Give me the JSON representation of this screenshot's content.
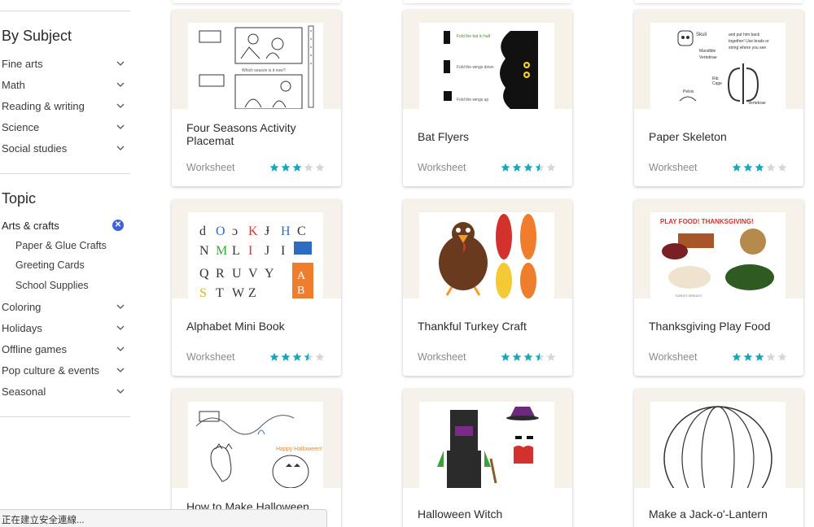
{
  "sidebar": {
    "subject_heading": "By Subject",
    "subjects": [
      {
        "label": "Fine arts"
      },
      {
        "label": "Math"
      },
      {
        "label": "Reading & writing"
      },
      {
        "label": "Science"
      },
      {
        "label": "Social studies"
      }
    ],
    "topic_heading": "Topic",
    "active_topic": "Arts & crafts",
    "active_subtopics": [
      "Paper & Glue Crafts",
      "Greeting Cards",
      "School Supplies"
    ],
    "topics": [
      {
        "label": "Coloring"
      },
      {
        "label": "Holidays"
      },
      {
        "label": "Offline games"
      },
      {
        "label": "Pop culture & events"
      },
      {
        "label": "Seasonal"
      }
    ]
  },
  "cards": [
    {
      "title": "Four Seasons Activity Placemat",
      "type": "Worksheet",
      "rating": 3
    },
    {
      "title": "Bat Flyers",
      "type": "Worksheet",
      "rating": 3.5
    },
    {
      "title": "Paper Skeleton",
      "type": "Worksheet",
      "rating": 3
    },
    {
      "title": "Alphabet Mini Book",
      "type": "Worksheet",
      "rating": 3.5
    },
    {
      "title": "Thankful Turkey Craft",
      "type": "Worksheet",
      "rating": 3.5
    },
    {
      "title": "Thanksgiving Play Food",
      "type": "Worksheet",
      "rating": 3
    },
    {
      "title": "How to Make Halloween",
      "type": "",
      "rating": 0
    },
    {
      "title": "Halloween Witch",
      "type": "",
      "rating": 0
    },
    {
      "title": "Make a Jack-o'-Lantern",
      "type": "",
      "rating": 0
    }
  ],
  "colors": {
    "star_on": "#14a9b8",
    "star_off": "#d6d6d6",
    "clear_badge": "#3d64d8"
  },
  "status_bar": "正在建立安全連線..."
}
